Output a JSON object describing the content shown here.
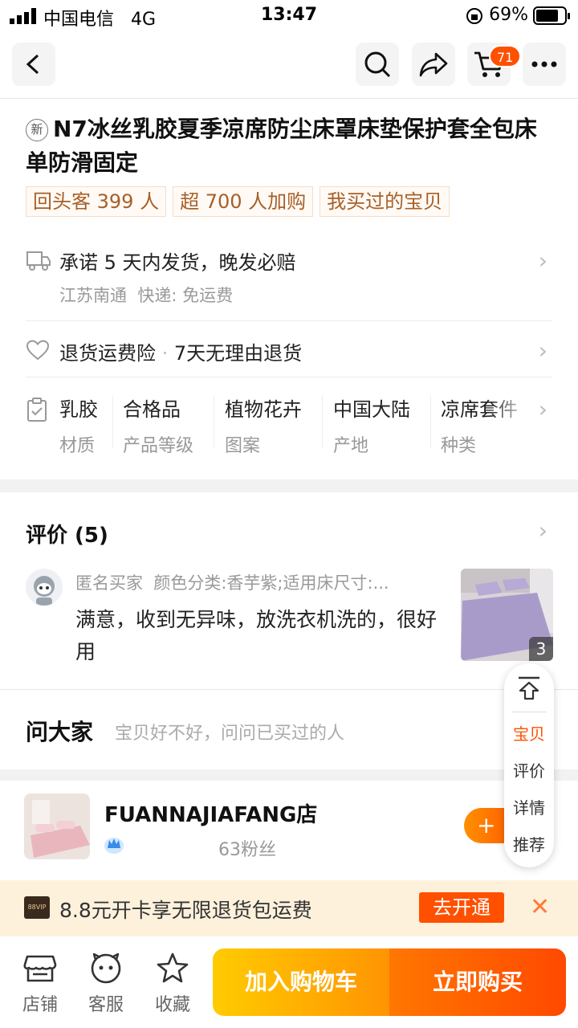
{
  "status_bar": {
    "carrier": "中国电信",
    "network": "4G",
    "time": "13:47",
    "battery": "69%"
  },
  "nav": {
    "cart_count": "71",
    "icons": [
      "back-icon",
      "search-icon",
      "share-icon",
      "cart-icon",
      "more-icon"
    ]
  },
  "product": {
    "new_badge": "新",
    "title": "N7冰丝乳胶夏季凉席防尘床罩床垫保护套全包床单防滑固定",
    "tags": [
      "回头客 399 人",
      "超 700 人加购",
      "我买过的宝贝"
    ]
  },
  "shipping": {
    "promise": "承诺 5 天内发货，晚发必赔",
    "origin": "江苏南通",
    "courier": "快递: 免运费"
  },
  "returns": {
    "insurance": "退货运费险",
    "policy": "7天无理由退货"
  },
  "attributes": [
    {
      "value": "乳胶",
      "key": "材质"
    },
    {
      "value": "合格品",
      "key": "产品等级"
    },
    {
      "value": "植物花卉",
      "key": "图案"
    },
    {
      "value": "中国大陆",
      "key": "产地"
    },
    {
      "value": "凉席套件",
      "key": "种类"
    }
  ],
  "reviews": {
    "title": "评价 (5)",
    "reviewer": "匿名买家",
    "spec": "颜色分类:香芋紫;适用床尺寸:...",
    "body": "满意，收到无异味，放洗衣机洗的，很好用",
    "image_count": "3"
  },
  "ask": {
    "title": "问大家",
    "hint": "宝贝好不好，问问已买过的人"
  },
  "shop": {
    "name": "FUANNAJIAFANG店",
    "fans": "63粉丝",
    "follow": "+ 关"
  },
  "float_nav": {
    "items": [
      "宝贝",
      "评价",
      "详情",
      "推荐"
    ],
    "active": "宝贝"
  },
  "vip_banner": {
    "logo": "88VIP",
    "text": "8.8元开卡享无限退货包运费",
    "button": "去开通"
  },
  "bottom_bar": {
    "items": [
      "店铺",
      "客服",
      "收藏"
    ],
    "add_to_cart": "加入购物车",
    "buy_now": "立即购买"
  },
  "colors": {
    "accent": "#ff5000",
    "tag_text": "#a85f26",
    "cta_yellow": "#ffcb00",
    "cta_orange": "#ff4900"
  }
}
